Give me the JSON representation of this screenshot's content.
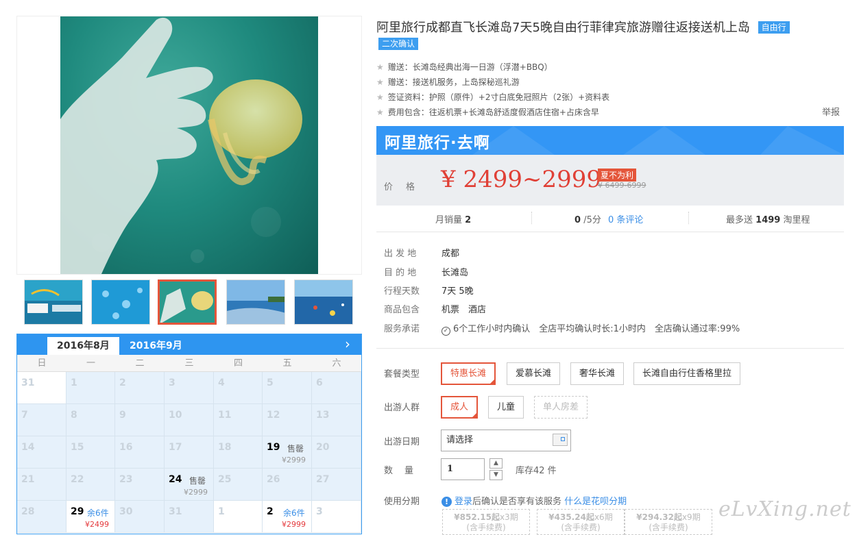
{
  "product": {
    "title": "阿里旅行成都直飞长滩岛7天5晚自由行菲律宾旅游赠往返接送机上岛",
    "badge_free": "自由行",
    "badge_confirm": "二次确认",
    "gifts": [
      "赠送：长滩岛经典出海一日游（浮潜+BBQ）",
      "赠送：接送机服务，上岛探秘巡礼游",
      "签证资料：护照（原件）+2寸白底免冠照片（2张）+资料表",
      "费用包含：往返机票+长滩岛舒适度假酒店住宿+占床含早"
    ],
    "report_link": "举报",
    "star_icon": "★"
  },
  "promo": {
    "text": "阿里旅行·去啊",
    "color": "#3396f5"
  },
  "price": {
    "label": "价　格",
    "range": "¥ 2499~2999",
    "sale_tag": "夏不为利",
    "original": "¥ 6499-6999",
    "color": "#e04036"
  },
  "stats": {
    "monthly_sales_label": "月销量",
    "monthly_sales_value": "2",
    "rating_value": "0",
    "rating_suffix": "/5分",
    "reviews_link": "0 条评论",
    "points_prefix": "最多送",
    "points_value": "1499",
    "points_suffix": "淘里程"
  },
  "info": [
    {
      "key": "出 发 地",
      "value": "成都"
    },
    {
      "key": "目 的 地",
      "value": "长滩岛"
    },
    {
      "key": "行程天数",
      "value": "7天 5晚"
    },
    {
      "key": "商品包含",
      "value": "机票　酒店"
    },
    {
      "key": "服务承诺",
      "value": "6个工作小时内确认　全店平均确认时长:1小时内　全店确认通过率:99%"
    }
  ],
  "options": {
    "package_label": "套餐类型",
    "packages": [
      "特惠长滩",
      "爱慕长滩",
      "奢华长滩",
      "长滩自由行住香格里拉"
    ],
    "traveler_label": "出游人群",
    "travelers": [
      "成人",
      "儿童",
      "单人房差"
    ],
    "date_label": "出游日期",
    "date_placeholder": "请选择",
    "qty_label": "数　量",
    "qty_value": "1",
    "stock": "库存42 件",
    "installment_label": "使用分期",
    "installment_login": "登录",
    "installment_text": "后确认是否享有该服务",
    "installment_link": "什么是花呗分期",
    "installments": [
      {
        "amount": "¥852.15起",
        "times": "x3期",
        "note": "(含手续费)"
      },
      {
        "amount": "¥435.24起",
        "times": "x6期",
        "note": "(含手续费)"
      },
      {
        "amount": "¥294.32起",
        "times": "x9期",
        "note": "(含手续费)"
      }
    ]
  },
  "calendar": {
    "tabs": [
      "2016年8月",
      "2016年9月"
    ],
    "next_icon": "›",
    "weekdays": [
      "日",
      "一",
      "二",
      "三",
      "四",
      "五",
      "六"
    ],
    "weeks": [
      [
        {
          "d": "31",
          "w": 1
        },
        {
          "d": "1"
        },
        {
          "d": "2"
        },
        {
          "d": "3"
        },
        {
          "d": "4"
        },
        {
          "d": "5"
        },
        {
          "d": "6"
        }
      ],
      [
        {
          "d": "7"
        },
        {
          "d": "8"
        },
        {
          "d": "9"
        },
        {
          "d": "10"
        },
        {
          "d": "11"
        },
        {
          "d": "12"
        },
        {
          "d": "13"
        }
      ],
      [
        {
          "d": "14"
        },
        {
          "d": "15"
        },
        {
          "d": "16"
        },
        {
          "d": "17"
        },
        {
          "d": "18"
        },
        {
          "d": "19",
          "on": 1,
          "s": "售罄",
          "p": "¥2999"
        },
        {
          "d": "20"
        }
      ],
      [
        {
          "d": "21"
        },
        {
          "d": "22"
        },
        {
          "d": "23"
        },
        {
          "d": "24",
          "on": 1,
          "s": "售罄",
          "p": "¥2999"
        },
        {
          "d": "25"
        },
        {
          "d": "26"
        },
        {
          "d": "27"
        }
      ],
      [
        {
          "d": "28"
        },
        {
          "d": "29",
          "on": 1,
          "w": 1,
          "s": "余6件",
          "blue": 1,
          "p": "¥2499",
          "red": 1
        },
        {
          "d": "30"
        },
        {
          "d": "31"
        },
        {
          "d": "1",
          "w": 1
        },
        {
          "d": "2",
          "on": 1,
          "w": 1,
          "s": "余6件",
          "blue": 1,
          "p": "¥2999",
          "red": 1
        },
        {
          "d": "3",
          "w": 1
        }
      ]
    ]
  },
  "watermark": "eLvXing.net"
}
